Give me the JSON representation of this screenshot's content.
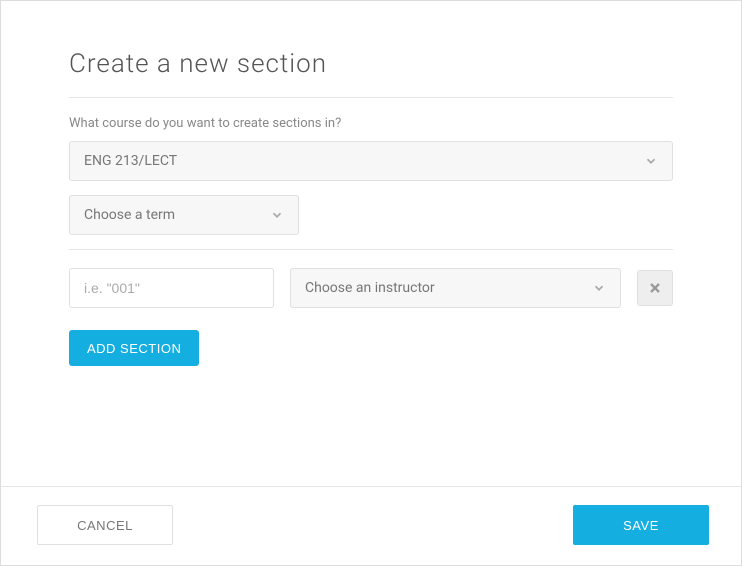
{
  "title": "Create a new section",
  "course_question": "What course do you want to create sections in?",
  "course_select": {
    "value": "ENG 213/LECT"
  },
  "term_select": {
    "placeholder": "Choose a term"
  },
  "section_row": {
    "section_number_placeholder": "i.e. \"001\"",
    "instructor_placeholder": "Choose an instructor"
  },
  "buttons": {
    "add_section": "ADD SECTION",
    "cancel": "CANCEL",
    "save": "SAVE"
  }
}
